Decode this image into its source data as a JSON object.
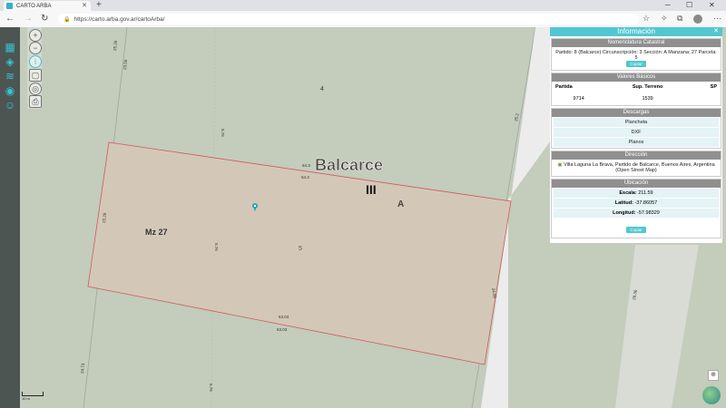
{
  "browser": {
    "tab_title": "CARTO ARBA",
    "url": "https://carto.arba.gov.ar/cartoArba/",
    "icons": [
      "back-arrow",
      "forward-arrow",
      "refresh",
      "lock",
      "star",
      "extensions",
      "collections",
      "profile",
      "more"
    ]
  },
  "map": {
    "block_label": "Mz 27",
    "city_label": "Balcarce",
    "roman_label": "III",
    "section_label": "A",
    "parcel_numbers": [
      "4",
      "5"
    ],
    "dimensions": [
      "64.3",
      "64.3",
      "63.03",
      "63.03",
      "23.28",
      "24.06",
      "25.2",
      "24.73",
      "25.26",
      "23.56",
      "5.76",
      "5.76",
      "5.76",
      "26.36"
    ],
    "scale_label": "10 m",
    "colors": {
      "parcel_fill": "#d3c8b8",
      "parcel_border": "#d05a5a",
      "map_bg": "#c4ccbc",
      "road": "#ececec",
      "accent": "#35c4d8"
    }
  },
  "panel": {
    "title": "Información",
    "nomenclatura": {
      "header": "Nomenclatura Catastral",
      "text": "Partido: 8 (Balcarce) Circunscripción: 3 Sección: A Manzana: 27 Parcela: 5",
      "button": "Copiar"
    },
    "valores": {
      "header": "Valores Básicos",
      "columns": [
        "Partida",
        "Sup. Terreno",
        "SP"
      ],
      "row": [
        "9714",
        "1539",
        ""
      ]
    },
    "descargas": {
      "header": "Descargas",
      "items": [
        "Plancheta",
        "DXF",
        "Planos"
      ]
    },
    "direccion": {
      "header": "Dirección",
      "text": "Villa Laguna La Brava, Partido de Balcarce, Buenos Aires, Argentina (Open Street Map)"
    },
    "ubicacion": {
      "header": "Ubicación",
      "escala_label": "Escala:",
      "escala_value": "211.59",
      "latitud_label": "Latitud:",
      "latitud_value": "-37.86057",
      "longitud_label": "Longitud:",
      "longitud_value": "-57.98329",
      "button": "Copiar"
    }
  }
}
